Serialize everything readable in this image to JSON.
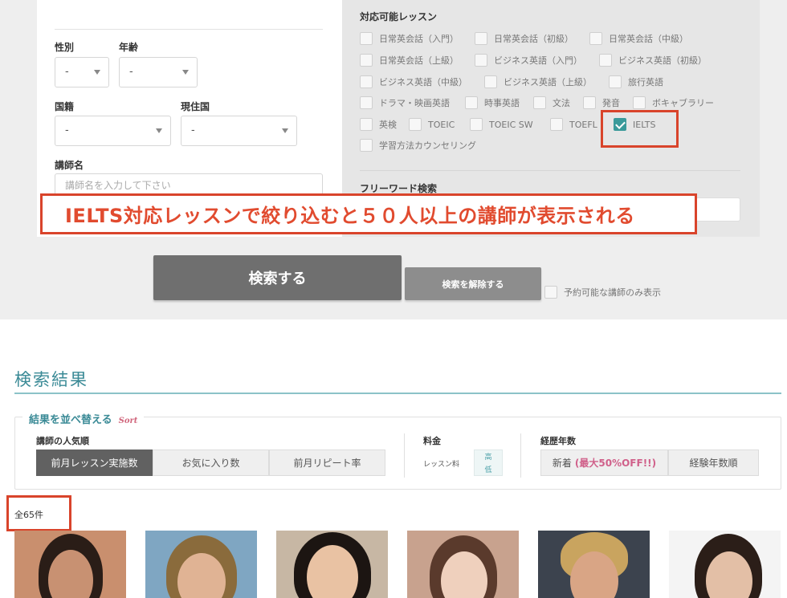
{
  "search_form": {
    "gender_label": "性別",
    "gender_value": "-",
    "age_label": "年齢",
    "age_value": "-",
    "nationality_label": "国籍",
    "nationality_value": "-",
    "residence_label": "現住国",
    "residence_value": "-",
    "teacher_name_label": "講師名",
    "teacher_name_placeholder": "講師名を入力して下さい",
    "lessons_label": "対応可能レッスン",
    "lessons": [
      {
        "label": "日常英会話（入門）",
        "checked": false
      },
      {
        "label": "日常英会話（初級）",
        "checked": false
      },
      {
        "label": "日常英会話（中級）",
        "checked": false
      },
      {
        "label": "日常英会話（上級）",
        "checked": false
      },
      {
        "label": "ビジネス英語（入門）",
        "checked": false
      },
      {
        "label": "ビジネス英語（初級）",
        "checked": false
      },
      {
        "label": "ビジネス英語（中級）",
        "checked": false
      },
      {
        "label": "ビジネス英語（上級）",
        "checked": false
      },
      {
        "label": "旅行英語",
        "checked": false
      },
      {
        "label": "ドラマ・映画英語",
        "checked": false
      },
      {
        "label": "時事英語",
        "checked": false
      },
      {
        "label": "文法",
        "checked": false
      },
      {
        "label": "発音",
        "checked": false
      },
      {
        "label": "ボキャブラリー",
        "checked": false
      },
      {
        "label": "英検",
        "checked": false
      },
      {
        "label": "TOEIC",
        "checked": false
      },
      {
        "label": "TOEIC SW",
        "checked": false
      },
      {
        "label": "TOEFL",
        "checked": false
      },
      {
        "label": "IELTS",
        "checked": true
      },
      {
        "label": "学習方法カウンセリング",
        "checked": false
      }
    ],
    "free_word_label": "フリーワード検索",
    "search_button": "検索する",
    "clear_button": "検索を解除する",
    "available_only_label": "予約可能な講師のみ表示"
  },
  "annotation": {
    "banner_text": "IELTS対応レッスンで絞り込むと５０人以上の講師が表示される",
    "highlight_color": "#d9442b"
  },
  "results": {
    "title": "検索結果",
    "sort_title": "結果を並べ替える",
    "sort_subtitle": "Sort",
    "popularity_label": "講師の人気順",
    "popularity_options": [
      "前月レッスン実施数",
      "お気に入り数",
      "前月リピート率"
    ],
    "price_label": "料金",
    "price_sub_label": "レッスン料",
    "price_high": "高",
    "price_low": "低",
    "experience_label": "経歴年数",
    "experience_new_prefix": "新着",
    "experience_new_discount": "(最大50%OFF!!)",
    "experience_years": "経験年数順",
    "total_count": "全65件"
  },
  "colors": {
    "accent_teal": "#3a8a96",
    "checkbox_checked": "#3a9a9a",
    "search_button_bg": "#6f6f6f",
    "discount_pink": "#d0608a"
  }
}
